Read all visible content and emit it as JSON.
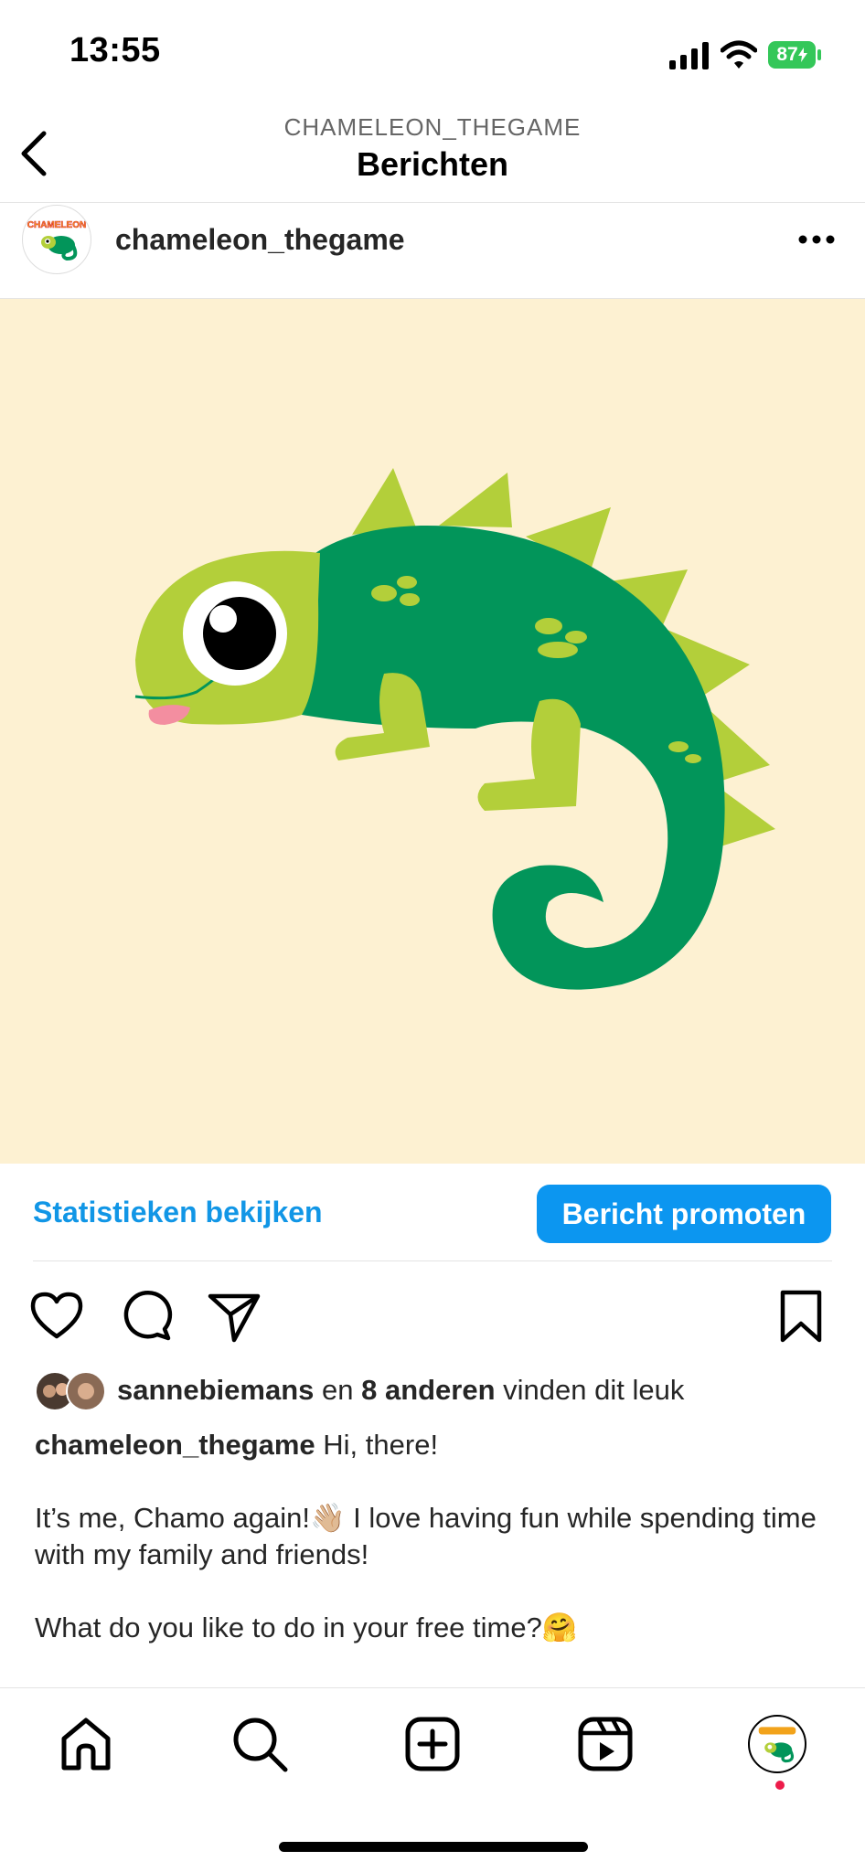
{
  "status_bar": {
    "time": "13:55",
    "battery": "87"
  },
  "header": {
    "subtitle": "CHAMELEON_THEGAME",
    "title": "Berichten"
  },
  "post": {
    "username": "chameleon_thegame",
    "avatar_logo": "CHAMELEON",
    "image_background": "#fdf1d2"
  },
  "actions": {
    "stats_label": "Statistieken bekijken",
    "promote_label": "Bericht promoten"
  },
  "icons": {
    "like": "heart-icon",
    "comment": "comment-icon",
    "share": "send-icon",
    "save": "bookmark-icon"
  },
  "likes": {
    "user": "sannebiemans",
    "connector": " en ",
    "others": "8 anderen",
    "suffix": " vinden dit leuk"
  },
  "caption": {
    "username": "chameleon_thegame",
    "line1": " Hi, there!",
    "para2": "It’s me, Chamo again!👋🏼 I love having fun while spending time with my family and friends!",
    "para3": "What do you like to do in your free time?🤗"
  },
  "tab_bar": [
    "home-icon",
    "search-icon",
    "create-post-icon",
    "reels-icon",
    "profile-avatar"
  ],
  "colors": {
    "accent_blue": "#0c96f0",
    "link_blue": "#1196e6",
    "chameleon_dark": "#02955a",
    "chameleon_light": "#b3cf3a",
    "notification_dot": "#ed1c4a"
  }
}
